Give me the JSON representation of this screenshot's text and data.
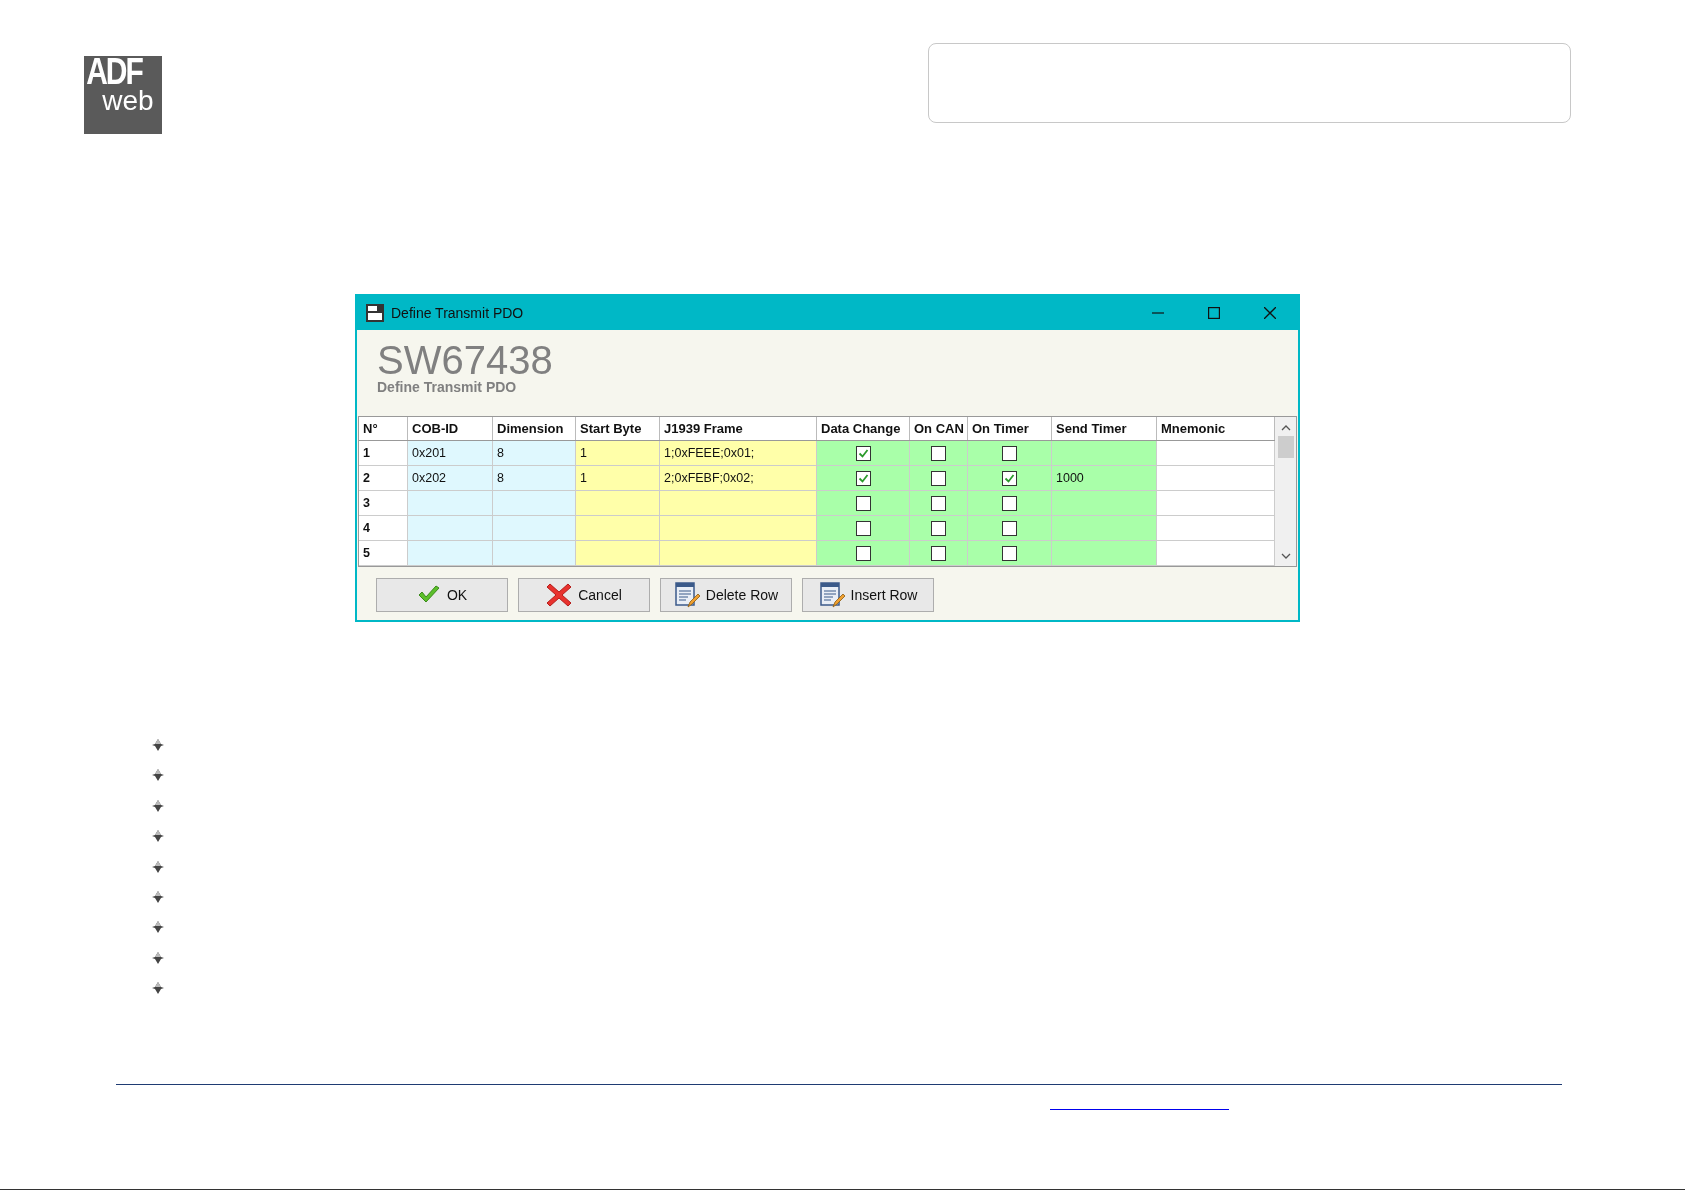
{
  "logo": {
    "top": "ADF",
    "bottom": "web"
  },
  "dialog": {
    "title": "Define Transmit PDO",
    "heading": "SW67438",
    "subheading": "Define Transmit PDO",
    "table": {
      "columns": [
        {
          "label": "N°",
          "kind": "index"
        },
        {
          "label": "COB-ID",
          "kind": "cyan"
        },
        {
          "label": "Dimension",
          "kind": "cyan"
        },
        {
          "label": "Start Byte",
          "kind": "yellow"
        },
        {
          "label": "J1939 Frame",
          "kind": "yellow"
        },
        {
          "label": "Data Change",
          "kind": "check"
        },
        {
          "label": "On CAN",
          "kind": "check"
        },
        {
          "label": "On Timer",
          "kind": "check"
        },
        {
          "label": "Send Timer",
          "kind": "green"
        },
        {
          "label": "Mnemonic",
          "kind": "white"
        }
      ],
      "rows": [
        {
          "cells": [
            "1",
            "0x201",
            "8",
            "1",
            "1;0xFEEE;0x01;",
            true,
            false,
            false,
            null,
            null
          ]
        },
        {
          "cells": [
            "2",
            "0x202",
            "8",
            "1",
            "2;0xFEBF;0x02;",
            true,
            false,
            true,
            "1000",
            null
          ]
        },
        {
          "cells": [
            "3",
            null,
            null,
            null,
            null,
            false,
            false,
            false,
            null,
            null
          ]
        },
        {
          "cells": [
            "4",
            null,
            null,
            null,
            null,
            false,
            false,
            false,
            null,
            null
          ]
        },
        {
          "cells": [
            "5",
            null,
            null,
            null,
            null,
            false,
            false,
            false,
            null,
            null
          ]
        }
      ]
    },
    "buttons": [
      {
        "label": "OK",
        "kind": "ok"
      },
      {
        "label": "Cancel",
        "kind": "cancel"
      },
      {
        "label": "Delete Row",
        "kind": "delete"
      },
      {
        "label": "Insert Row",
        "kind": "insert"
      }
    ]
  },
  "bullets": [
    {
      "kind": "bullet"
    },
    {
      "kind": "bullet"
    },
    {
      "kind": "bullet"
    },
    {
      "kind": "bullet"
    },
    {
      "kind": "bullet"
    },
    {
      "kind": "bullet"
    },
    {
      "kind": "bullet"
    },
    {
      "kind": "bullet"
    },
    {
      "kind": "bullet"
    }
  ]
}
